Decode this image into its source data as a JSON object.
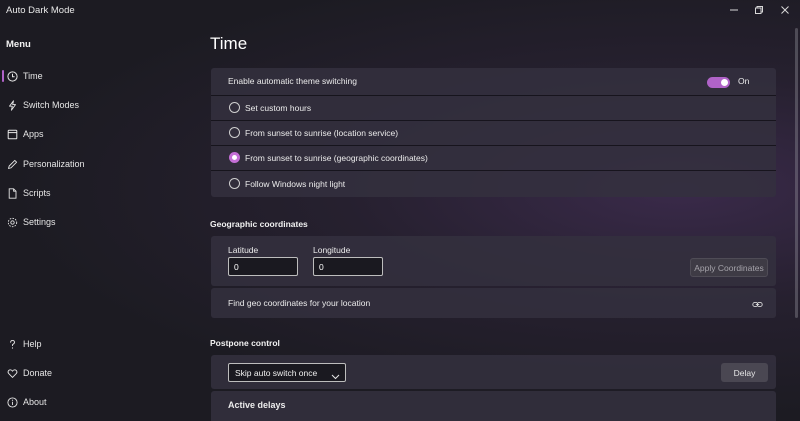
{
  "window": {
    "title": "Auto Dark Mode",
    "controls": [
      "minimize-icon",
      "restore-icon",
      "close-icon"
    ]
  },
  "sidebar": {
    "header": "Menu",
    "items": [
      {
        "label": "Time",
        "icon": "clock-icon",
        "selected": true
      },
      {
        "label": "Switch Modes",
        "icon": "lightning-icon",
        "selected": false
      },
      {
        "label": "Apps",
        "icon": "apps-icon",
        "selected": false
      },
      {
        "label": "Personalization",
        "icon": "pen-icon",
        "selected": false
      },
      {
        "label": "Scripts",
        "icon": "document-icon",
        "selected": false
      },
      {
        "label": "Settings",
        "icon": "gear-icon",
        "selected": false
      }
    ],
    "footer_items": [
      {
        "label": "Help",
        "icon": "question-icon"
      },
      {
        "label": "Donate",
        "icon": "heart-icon"
      },
      {
        "label": "About",
        "icon": "info-icon"
      }
    ]
  },
  "page": {
    "title": "Time"
  },
  "theme_switching": {
    "label": "Enable automatic theme switching",
    "toggle_state": "On",
    "enabled": true,
    "options": [
      {
        "label": "Set custom hours",
        "checked": false
      },
      {
        "label": "From sunset to sunrise (location service)",
        "checked": false
      },
      {
        "label": "From sunset to sunrise (geographic coordinates)",
        "checked": true
      },
      {
        "label": "Follow Windows night light",
        "checked": false
      }
    ]
  },
  "geo": {
    "section_title": "Geographic coordinates",
    "latitude_label": "Latitude",
    "latitude_value": "0",
    "longitude_label": "Longitude",
    "longitude_value": "0",
    "apply_button": "Apply Coordinates",
    "find_link": "Find geo coordinates for your location",
    "link_icon": "link-icon"
  },
  "postpone": {
    "section_title": "Postpone control",
    "select_value": "Skip auto switch once",
    "delay_button": "Delay",
    "active_delays_title": "Active delays"
  },
  "colors": {
    "accent": "#b063c8",
    "background": "#1c1b22",
    "card": "#34303e"
  }
}
